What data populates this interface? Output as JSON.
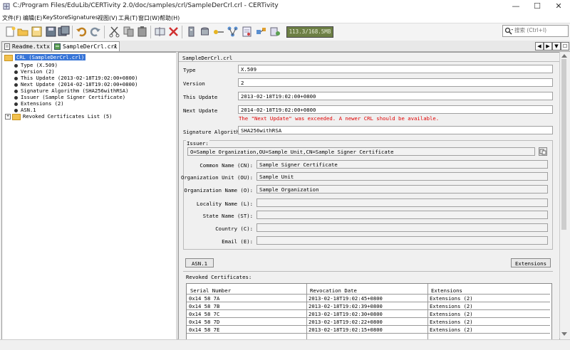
{
  "window": {
    "title": "C:/Program Files/EduLib/CERTivity 2.0/doc/samples/crl/SampleDerCrl.crl - CERTivity",
    "minimize": "—",
    "maximize": "☐",
    "close": "✕"
  },
  "menu": [
    "文件(F)",
    "编辑(E)",
    "KeyStore",
    "Signatures",
    "视图(V)",
    "工具(T)",
    "窗口(W)",
    "帮助(H)"
  ],
  "toolbar": {
    "memory": "113.3/168.5MB",
    "search_placeholder": "搜索 (Ctrl+I)"
  },
  "tabs": [
    {
      "label": "Readme.txt",
      "close": "x"
    },
    {
      "label": "SampleDerCrl.crl",
      "close": "x"
    }
  ],
  "tab_nav": [
    "◀",
    "▶",
    "▼",
    "☐"
  ],
  "tree": {
    "root": "CRL (SampleDerCrl.crl)",
    "items": [
      "Type (X.509)",
      "Version (2)",
      "This Update (2013-02-18T19:02:00+0800)",
      "Next Update (2014-02-18T19:02:00+0800)",
      "Signature Algorithm (SHA256withRSA)",
      "Issuer (Sample Signer Certificate)",
      "Extensions (2)",
      "ASN.1"
    ],
    "revoked": "Revoked Certificates List (5)",
    "revoked_expander": "+"
  },
  "details": {
    "header": "SampleDerCrl.crl",
    "type_label": "Type",
    "type_value": "X.509",
    "version_label": "Version",
    "version_value": "2",
    "this_update_label": "This Update",
    "this_update_value": "2013-02-18T19:02:00+0800",
    "next_update_label": "Next Update",
    "next_update_value": "2014-02-18T19:02:00+0800",
    "warning": "The \"Next Update\" was exceeded. A newer CRL should be available.",
    "sigalg_label": "Signature Algorithm",
    "sigalg_value": "SHA256withRSA",
    "issuer_label": "Issuer:",
    "issuer_dn": "O=Sample Organization,OU=Sample Unit,CN=Sample Signer Certificate",
    "cn_label": "Common Name (CN):",
    "cn_value": "Sample Signer Certificate",
    "ou_label": "Organization Unit (OU):",
    "ou_value": "Sample Unit",
    "o_label": "Organization Name (O):",
    "o_value": "Sample Organization",
    "l_label": "Locality Name (L):",
    "l_value": "",
    "st_label": "State Name (ST):",
    "st_value": "",
    "c_label": "Country (C):",
    "c_value": "",
    "e_label": "Email (E):",
    "e_value": "",
    "asn1_button": "ASN.1",
    "extensions_button": "Extensions",
    "revoked_label": "Revoked Certificates:"
  },
  "revoked_table": {
    "columns": [
      "Serial Number",
      "Revocation Date",
      "Extensions"
    ],
    "rows": [
      [
        "0x14 58 7A",
        "2013-02-18T19:02:45+0800",
        "Extensions (2)"
      ],
      [
        "0x14 58 7B",
        "2013-02-18T19:02:39+0800",
        "Extensions (2)"
      ],
      [
        "0x14 58 7C",
        "2013-02-18T19:02:30+0800",
        "Extensions (2)"
      ],
      [
        "0x14 58 7D",
        "2013-02-18T19:02:22+0800",
        "Extensions (2)"
      ],
      [
        "0x14 58 7E",
        "2013-02-18T19:02:15+0800",
        "Extensions (2)"
      ]
    ]
  }
}
